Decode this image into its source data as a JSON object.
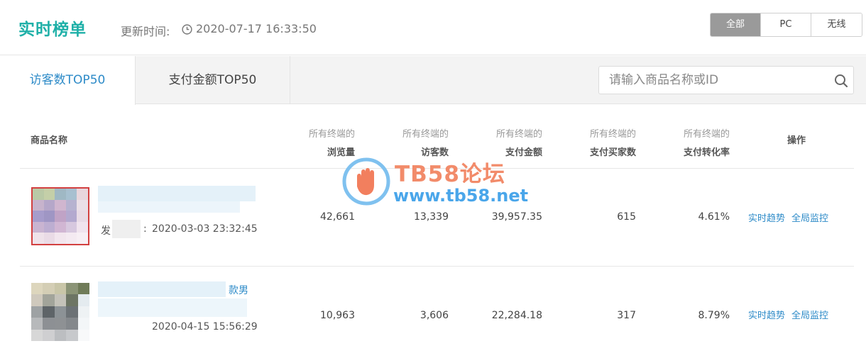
{
  "header": {
    "title": "实时榜单",
    "update_label": "更新时间:",
    "update_time": "2020-07-17 16:33:50",
    "segments": [
      "全部",
      "PC",
      "无线"
    ],
    "active_segment": "全部"
  },
  "tabs": {
    "active": "访客数TOP50",
    "inactive": "支付金额TOP50"
  },
  "search": {
    "placeholder": "请输入商品名称或ID"
  },
  "table": {
    "col_name": "商品名称",
    "metric_prefix": "所有终端的",
    "metrics": [
      "浏览量",
      "访客数",
      "支付金额",
      "支付买家数",
      "支付转化率"
    ],
    "col_ops": "操作",
    "rows": [
      {
        "title_fragment": "",
        "time_prefix": "发",
        "time_sep": ":",
        "time": "2020-03-03 23:32:45",
        "pv": "42,661",
        "uv": "13,339",
        "amount": "39,957.35",
        "buyers": "615",
        "rate": "4.61%"
      },
      {
        "title_fragment": "款男",
        "time_prefix": "",
        "time_sep": "",
        "time": "2020-04-15 15:56:29",
        "pv": "10,963",
        "uv": "3,606",
        "amount": "22,284.18",
        "buyers": "317",
        "rate": "8.79%"
      }
    ],
    "op_trend": "实时趋势",
    "op_monitor": "全局监控"
  },
  "watermark": {
    "title": "TB58论坛",
    "url": "www.tb58.net"
  },
  "colors": {
    "brand": "#1fb0a8",
    "link": "#2e8bc8",
    "segment_active": "#9a9a9a"
  }
}
